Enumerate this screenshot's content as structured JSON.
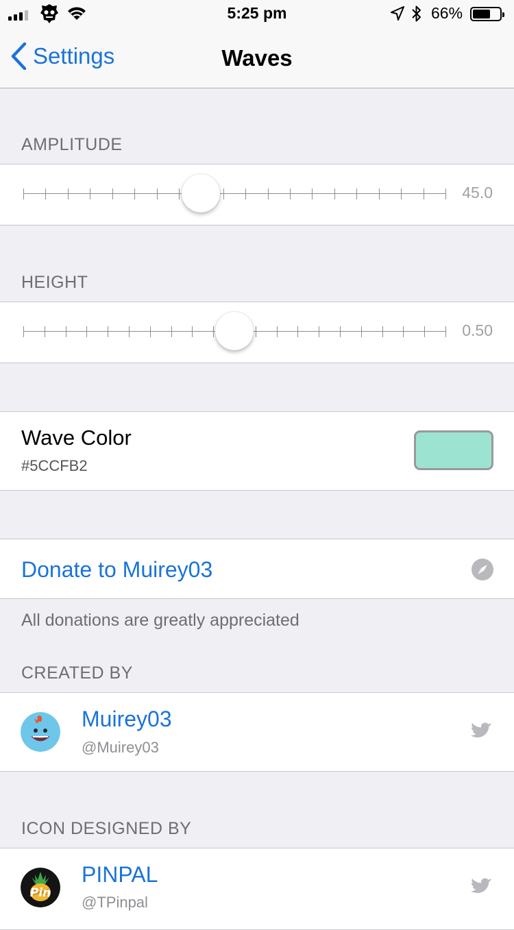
{
  "status_bar": {
    "time": "5:25 pm",
    "battery_percent": "66%",
    "battery_level": 0.66,
    "signal_bars_filled": 3,
    "signal_bars_total": 4
  },
  "nav": {
    "back_label": "Settings",
    "title": "Waves"
  },
  "amplitude": {
    "header": "AMPLITUDE",
    "value_text": "45.0",
    "position_fraction": 0.42,
    "tick_count": 20
  },
  "height": {
    "header": "HEIGHT",
    "value_text": "0.50",
    "position_fraction": 0.5,
    "tick_count": 21
  },
  "wave_color": {
    "label": "Wave Color",
    "hex": "#5CCFB2",
    "swatch_color": "#9de3d1"
  },
  "donate": {
    "label": "Donate to Muirey03",
    "footer": "All donations are greatly appreciated"
  },
  "created_by": {
    "header": "CREATED BY",
    "name": "Muirey03",
    "handle": "@Muirey03"
  },
  "icon_designed_by": {
    "header": "ICON DESIGNED BY",
    "name": "PINPAL",
    "handle": "@TPinpal",
    "avatar_text": "Pin"
  },
  "colors": {
    "accent": "#1a73d9",
    "background": "#efeff4",
    "secondary_text": "#6d6d72"
  }
}
